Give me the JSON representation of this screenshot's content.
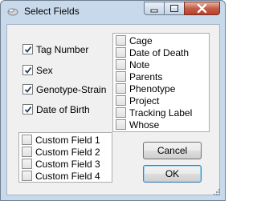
{
  "window": {
    "title": "Select Fields"
  },
  "checked_fields": [
    {
      "label": "Tag Number",
      "checked": true
    },
    {
      "label": "Sex",
      "checked": true
    },
    {
      "label": "Genotype-Strain",
      "checked": true
    },
    {
      "label": "Date of Birth",
      "checked": true
    }
  ],
  "available_fields": [
    {
      "label": "Cage",
      "checked": false
    },
    {
      "label": "Date of Death",
      "checked": false
    },
    {
      "label": "Note",
      "checked": false
    },
    {
      "label": "Parents",
      "checked": false
    },
    {
      "label": "Phenotype",
      "checked": false
    },
    {
      "label": "Project",
      "checked": false
    },
    {
      "label": "Tracking Label",
      "checked": false
    },
    {
      "label": "Whose",
      "checked": false
    }
  ],
  "custom_fields": [
    {
      "label": "Custom Field 1",
      "checked": false
    },
    {
      "label": "Custom Field 2",
      "checked": false
    },
    {
      "label": "Custom Field 3",
      "checked": false
    },
    {
      "label": "Custom Field 4",
      "checked": false
    }
  ],
  "buttons": {
    "cancel": "Cancel",
    "ok": "OK"
  }
}
